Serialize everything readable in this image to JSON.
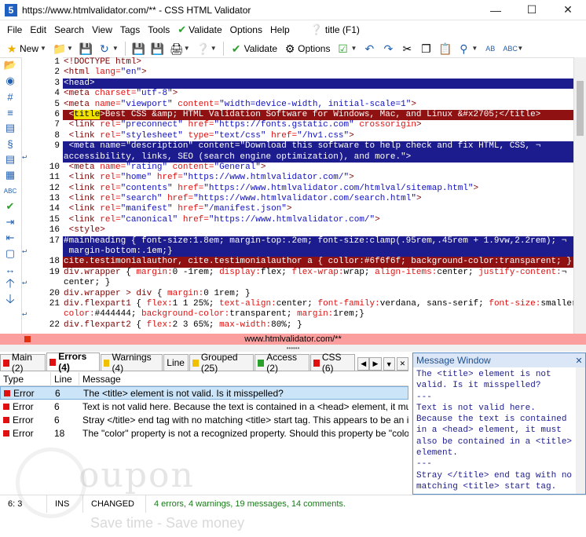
{
  "window": {
    "title": "https://www.htmlvalidator.com/** - CSS HTML Validator",
    "app_icon_letter": "5"
  },
  "menu": {
    "items": [
      "File",
      "Edit",
      "Search",
      "View",
      "Tags",
      "Tools",
      "Validate",
      "Options",
      "Help"
    ],
    "help_context": "title (F1)"
  },
  "toolbar": {
    "new_label": "New",
    "validate_label": "Validate",
    "options_label": "Options"
  },
  "editor": {
    "line_numbers": [
      "1",
      "2",
      "3",
      "4",
      "5",
      "6",
      "7",
      "8",
      "9",
      "",
      "10",
      "11",
      "12",
      "13",
      "14",
      "15",
      "16",
      "17",
      "",
      "18",
      "19",
      "",
      "20",
      "21",
      "",
      "22"
    ],
    "wrap_rows": [
      9,
      17,
      19,
      21
    ]
  },
  "document_tab": "www.htmlvalidator.com/**",
  "tabs": [
    {
      "label": "Main (2)",
      "color": "#e01010"
    },
    {
      "label": "Errors (4)",
      "color": "#e01010"
    },
    {
      "label": "Warnings (4)",
      "color": "#f0c000"
    },
    {
      "label": "Line",
      "color": ""
    },
    {
      "label": "Grouped (25)",
      "color": "#f0c000"
    },
    {
      "label": "Access (2)",
      "color": "#2aa02a"
    },
    {
      "label": "CSS (6)",
      "color": "#e01010"
    }
  ],
  "grid": {
    "headers": [
      "Type",
      "Line",
      "Message"
    ],
    "rows": [
      {
        "type": "Error",
        "line": "6",
        "message": "The <title> element is not valid. Is it misspelled?"
      },
      {
        "type": "Error",
        "line": "6",
        "message": "Text is not valid here. Because the text is contained in a <head> element, it must als..."
      },
      {
        "type": "Error",
        "line": "6",
        "message": "Stray </title> end tag with no matching <title> start tag. This appears to be an inval..."
      },
      {
        "type": "Error",
        "line": "18",
        "message": "The \"color\" property is not a recognized property. Should this property be \"color\"?"
      }
    ]
  },
  "message_window": {
    "title": "Message Window",
    "text": "The <title> element is not\nvalid. Is it misspelled?\n---\nText is not valid here.\nBecause the text is contained\nin a <head> element, it must\nalso be contained in a <title>\nelement.\n---\nStray </title> end tag with no\nmatching <title> start tag."
  },
  "statusbar": {
    "position": "6: 3",
    "mode": "INS",
    "state": "CHANGED",
    "summary": "4 errors, 4 warnings, 19 messages, 14 comments."
  },
  "watermark": {
    "brand": "oupon",
    "slogan": "Save time - Save money"
  }
}
